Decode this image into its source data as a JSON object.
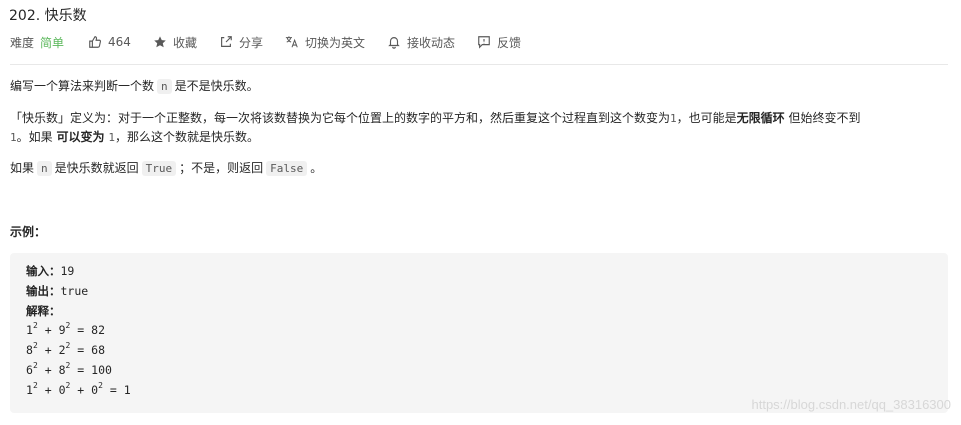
{
  "problem": {
    "title": "202. 快乐数",
    "difficulty_label": "难度",
    "difficulty_value": "简单",
    "likes": "464",
    "favorite": "收藏",
    "share": "分享",
    "translate": "切换为英文",
    "subscribe": "接收动态",
    "feedback": "反馈"
  },
  "description": {
    "p1_a": "编写一个算法来判断一个数",
    "p1_code": "n",
    "p1_b": "是不是快乐数。",
    "p2_a": "「快乐数」定义为：对于一个正整数，每一次将该数替换为它每个位置上的数字的平方和，然后重复这个过程直到这个数变为",
    "p2_one_a": "1",
    "p2_b": "，也可能是",
    "p2_bold_a": "无限循环",
    "p2_c": "但始终变不到",
    "p2_line2_one": "1",
    "p2_d": "。如果",
    "p2_bold_b": "可以变为",
    "p2_one_b": "1",
    "p2_e": "，那么这个数就是快乐数。",
    "p3_a": "如果",
    "p3_code_n": "n",
    "p3_b": "是快乐数就返回",
    "p3_code_true": "True",
    "p3_c": "；不是，则返回",
    "p3_code_false": "False",
    "p3_d": "。"
  },
  "example": {
    "label": "示例：",
    "input_label": "输入：",
    "input_value": "19",
    "output_label": "输出：",
    "output_value": "true",
    "explain_label": "解释：",
    "lines": [
      {
        "a": "1",
        "b": "9",
        "result": "82"
      },
      {
        "a": "8",
        "b": "2",
        "result": "68"
      },
      {
        "a": "6",
        "b": "8",
        "result": "100"
      },
      {
        "a": "1",
        "b": "0",
        "c": "0",
        "result": "1"
      }
    ],
    "exp": "2",
    "plus": "+",
    "equals": "="
  },
  "watermark": "https://blog.csdn.net/qq_38316300",
  "colors": {
    "difficulty_easy": "#5cb85c",
    "code_bg": "#f0f0f0",
    "example_bg": "#f5f5f5"
  },
  "icons": [
    "thumb-up-icon",
    "star-icon",
    "share-icon",
    "translate-icon",
    "bell-icon",
    "feedback-icon"
  ]
}
